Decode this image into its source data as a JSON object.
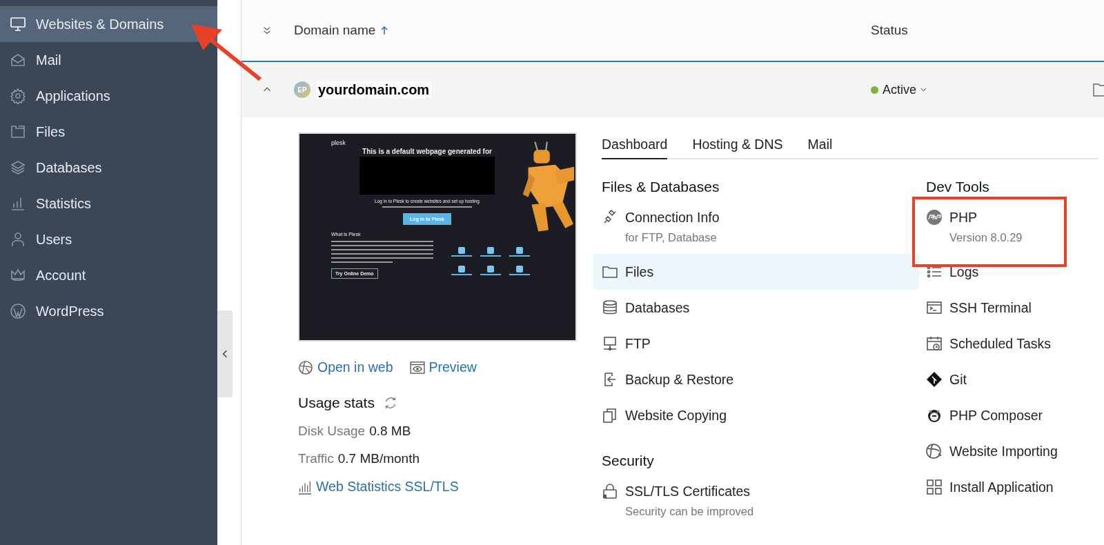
{
  "sidebar": {
    "items": [
      {
        "label": "Websites & Domains",
        "selected": true
      },
      {
        "label": "Mail",
        "selected": false
      },
      {
        "label": "Applications",
        "selected": false
      },
      {
        "label": "Files",
        "selected": false
      },
      {
        "label": "Databases",
        "selected": false
      },
      {
        "label": "Statistics",
        "selected": false
      },
      {
        "label": "Users",
        "selected": false
      },
      {
        "label": "Account",
        "selected": false
      },
      {
        "label": "WordPress",
        "selected": false
      }
    ]
  },
  "table": {
    "columns": [
      {
        "label": "Domain name",
        "sorted": true
      },
      {
        "label": "Status",
        "sorted": false
      }
    ],
    "row": {
      "expanded": true,
      "avatar": "EP",
      "domain": "yourdomain.com",
      "status": {
        "label": "Active",
        "color": "#7cb342"
      }
    }
  },
  "preview": {
    "logo": "plesk",
    "heading": "This is a default webpage generated for",
    "login_text": "Log in to Plesk to create websites and set up hosting",
    "login_button": "Log in to Plesk",
    "about_title": "What is Plesk",
    "demo_button": "Try Online Demo"
  },
  "links": [
    "Open in web",
    "Preview"
  ],
  "usage": {
    "title": "Usage stats",
    "stats": [
      {
        "label": "Disk Usage",
        "value": "0.8 MB"
      },
      {
        "label": "Traffic",
        "value": "0.7 MB/month"
      }
    ],
    "link": "Web Statistics SSL/TLS"
  },
  "tabs": [
    {
      "label": "Dashboard",
      "selected": true
    },
    {
      "label": "Hosting & DNS",
      "selected": false
    },
    {
      "label": "Mail",
      "selected": false
    }
  ],
  "sections": [
    {
      "title": "Files & Databases",
      "items": [
        {
          "label": "Connection Info",
          "sublabel": "for FTP, Database",
          "selected": false
        },
        {
          "label": "Files",
          "selected": true
        },
        {
          "label": "Databases",
          "selected": false
        },
        {
          "label": "FTP",
          "selected": false
        },
        {
          "label": "Backup & Restore",
          "selected": false
        },
        {
          "label": "Website Copying",
          "selected": false
        }
      ]
    },
    {
      "title": "Security",
      "items": [
        {
          "label": "SSL/TLS Certificates",
          "sublabel": "Security can be improved",
          "selected": false
        }
      ]
    },
    {
      "title": "Dev Tools",
      "items": [
        {
          "label": "PHP",
          "sublabel": "Version 8.0.29",
          "selected": false
        },
        {
          "label": "Logs",
          "selected": false
        },
        {
          "label": "SSH Terminal",
          "selected": false
        },
        {
          "label": "Scheduled Tasks",
          "selected": false
        },
        {
          "label": "Git",
          "selected": false
        },
        {
          "label": "PHP Composer",
          "selected": false
        },
        {
          "label": "Website Importing",
          "selected": false
        },
        {
          "label": "Install Application",
          "selected": false
        }
      ]
    }
  ]
}
